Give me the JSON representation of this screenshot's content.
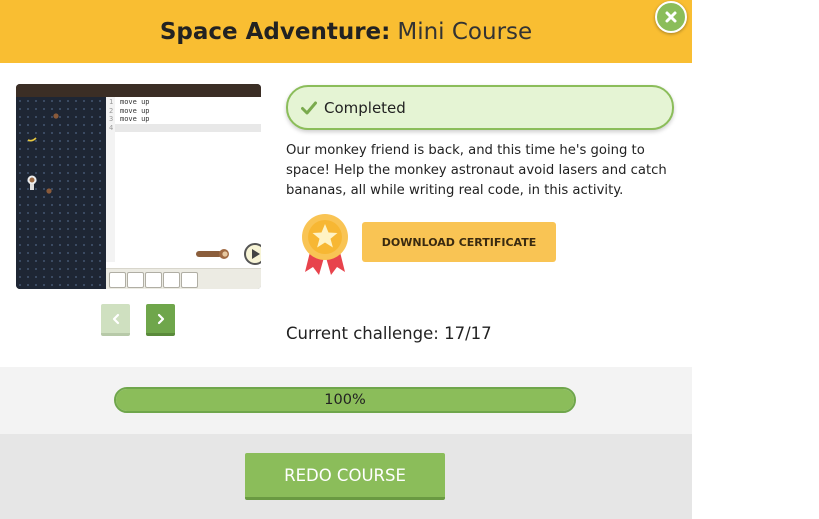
{
  "header": {
    "title_main": "Space Adventure:",
    "title_sub": "Mini Course",
    "color": "#f9be32"
  },
  "close_icon": "close-icon",
  "preview": {
    "code_lines": [
      "move up",
      "move up",
      "move up",
      ""
    ],
    "line_numbers": [
      "1",
      "2",
      "3",
      "4"
    ]
  },
  "nav": {
    "prev_icon": "chevron-left-icon",
    "next_icon": "chevron-right-icon"
  },
  "status": {
    "label": "Completed",
    "icon": "checkmark-icon",
    "color": "#8bbd5a"
  },
  "description": "Our monkey friend is back, and this time he's going to space! Help the monkey astronaut avoid lasers and catch bananas, all while writing real code, in this activity.",
  "certificate": {
    "icon": "award-ribbon-icon",
    "button_label": "DOWNLOAD CERTIFICATE"
  },
  "challenge": {
    "label": "Current challenge:",
    "value": "17/17"
  },
  "progress": {
    "percent": 100,
    "label": "100%"
  },
  "footer": {
    "redo_label": "REDO COURSE"
  }
}
